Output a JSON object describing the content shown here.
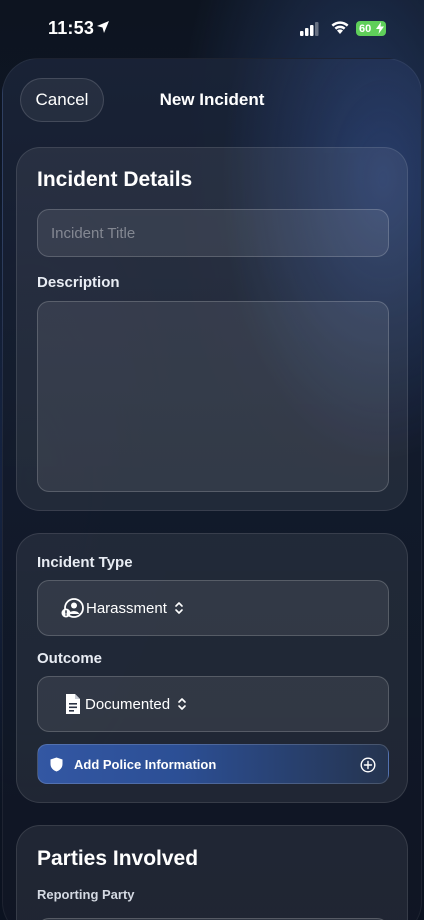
{
  "status_bar": {
    "time": "11:53",
    "battery": "60"
  },
  "nav": {
    "cancel_label": "Cancel",
    "title": "New Incident"
  },
  "details": {
    "heading": "Incident Details",
    "title_placeholder": "Incident Title",
    "description_label": "Description"
  },
  "classification": {
    "type_label": "Incident Type",
    "type_value": "Harassment",
    "outcome_label": "Outcome",
    "outcome_value": "Documented",
    "police_label": "Add Police Information"
  },
  "parties": {
    "heading": "Parties Involved",
    "reporting_label": "Reporting Party"
  },
  "colors": {
    "accent": "#3357a3",
    "battery": "#5fcf5a"
  },
  "icons": {
    "type": "person-warning-icon",
    "outcome": "document-icon",
    "police": "shield-icon",
    "add": "plus-circle-icon"
  }
}
